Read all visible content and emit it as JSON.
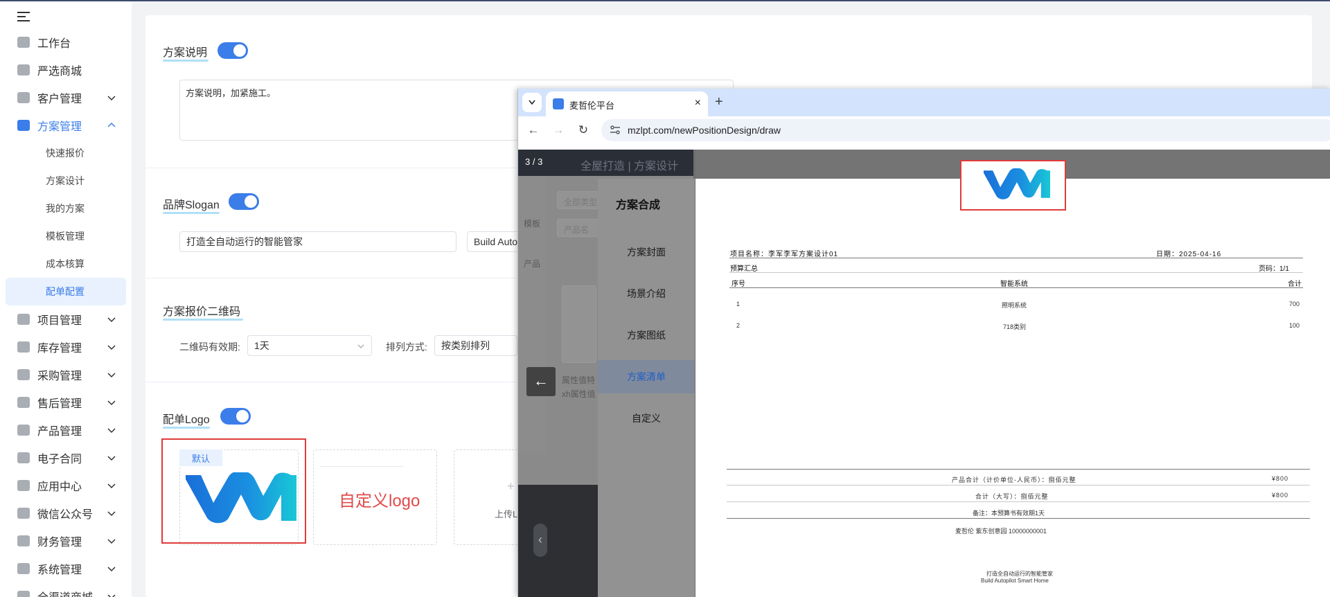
{
  "sidebar": {
    "items": [
      {
        "label": "工作台"
      },
      {
        "label": "严选商城"
      },
      {
        "label": "客户管理"
      },
      {
        "label": "方案管理"
      },
      {
        "label": "项目管理"
      },
      {
        "label": "库存管理"
      },
      {
        "label": "采购管理"
      },
      {
        "label": "售后管理"
      },
      {
        "label": "产品管理"
      },
      {
        "label": "电子合同"
      },
      {
        "label": "应用中心"
      },
      {
        "label": "微信公众号"
      },
      {
        "label": "财务管理"
      },
      {
        "label": "系统管理"
      },
      {
        "label": "全渠道商城"
      }
    ],
    "sub_items": [
      {
        "label": "快速报价"
      },
      {
        "label": "方案设计"
      },
      {
        "label": "我的方案"
      },
      {
        "label": "模板管理"
      },
      {
        "label": "成本核算"
      },
      {
        "label": "配单配置"
      }
    ]
  },
  "main": {
    "plan_desc": {
      "title": "方案说明",
      "text": "方案说明，加紧施工。"
    },
    "slogan": {
      "title": "品牌Slogan",
      "value": "打造全自动运行的智能管家",
      "value_en": "Build Auto"
    },
    "qrcode": {
      "title": "方案报价二维码",
      "validity_label": "二维码有效期:",
      "validity_value": "1天",
      "sort_label": "排列方式:",
      "sort_value": "按类别排列"
    },
    "logo": {
      "title": "配单Logo",
      "default_badge": "默认",
      "custom_text": "自定义logo",
      "upload_text": "上传L"
    }
  },
  "browser": {
    "tab_title": "麦哲伦平台",
    "tab_close": "×",
    "new_tab": "+",
    "url": "mzlpt.com/newPositionDesign/draw",
    "page_count": "3 / 3",
    "ghost_header": "全屋打造 | 方案设计",
    "ghost_left_nav": [
      "模板",
      "产品"
    ],
    "ghost_search": "全部类型",
    "ghost_product_name": "产品名",
    "ghost_attr": "属性值特",
    "ghost_attr2": "xh属性值",
    "panel_title": "方案合成",
    "panel_items": [
      {
        "label": "方案封面"
      },
      {
        "label": "场景介绍"
      },
      {
        "label": "方案图纸"
      },
      {
        "label": "方案清单"
      },
      {
        "label": "自定义"
      }
    ],
    "back_icon": "←",
    "doc": {
      "project_label": "项目名称：李军李军方案设计01",
      "date_label": "日期：2025-04-16",
      "summary_label": "预算汇总",
      "page_label": "页码：1/1",
      "columns": [
        "序号",
        "智能系统",
        "合计"
      ],
      "rows": [
        {
          "no": "1",
          "system": "照明系统",
          "total": "700"
        },
        {
          "no": "2",
          "system": "718类别",
          "total": "100"
        }
      ],
      "product_total_label": "产品合计（计价单位-人民币）：捌佰元整",
      "product_total_value": "¥800",
      "total_upper_label": "合计（大写）：捌佰元整",
      "total_upper_value": "¥800",
      "remark": "备注：本预算书有效期1天",
      "contact": "麦哲伦  紫东创意园  10000000001",
      "slogan_cn": "打造全自动运行的智能管家",
      "slogan_en": "Build Autopilot Smart Home"
    }
  },
  "colors": {
    "accent": "#3b7de9",
    "highlight_red": "#e03a3a",
    "logo_blue": "#1a6fd8",
    "logo_cyan": "#19c7d6"
  }
}
